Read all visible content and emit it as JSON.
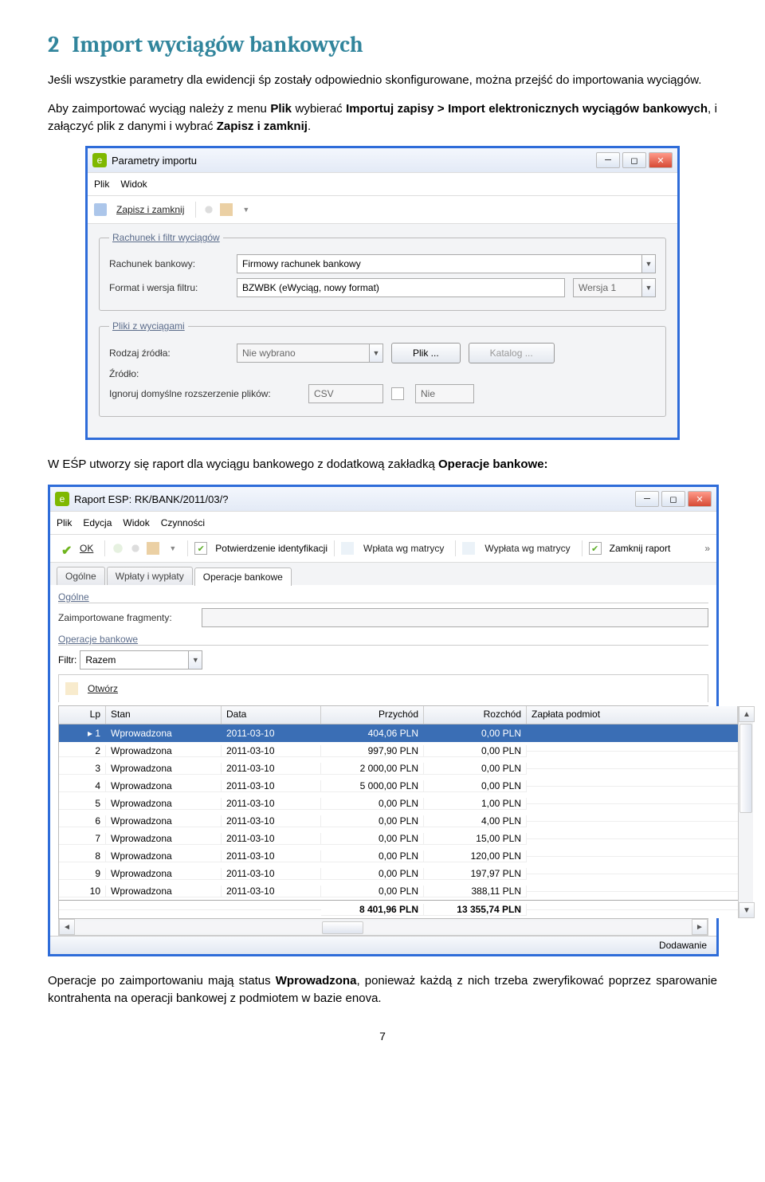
{
  "heading_num": "2",
  "heading_text": "Import wyciągów bankowych",
  "para1_a": "Jeśli wszystkie parametry dla ewidencji śp zostały odpowiednio skonfigurowane, można przejść do importowania wyciągów.",
  "para2_pre": "Aby zaimportować wyciąg należy z menu ",
  "para2_b1": "Plik",
  "para2_mid": " wybierać ",
  "para2_b2": "Importuj zapisy > Import elektronicznych wyciągów bankowych",
  "para2_mid2": ", i załączyć plik z danymi i wybrać ",
  "para2_b3": "Zapisz i zamknij",
  "para2_end": ".",
  "para3_pre": "W EŚP utworzy się raport dla wyciągu bankowego z dodatkową zakładką ",
  "para3_b": "Operacje bankowe:",
  "para4_pre": "Operacje po zaimportowaniu mają status ",
  "para4_b": "Wprowadzona",
  "para4_end": ", ponieważ każdą z nich trzeba zweryfikować poprzez sparowanie kontrahenta na operacji bankowej z podmiotem w bazie enova.",
  "page_num": "7",
  "win1": {
    "title": "Parametry importu",
    "menu": [
      "Plik",
      "Widok"
    ],
    "tb_save": "Zapisz i zamknij",
    "fs1": {
      "legend": "Rachunek i filtr wyciągów",
      "lbl_rach": "Rachunek bankowy:",
      "val_rach": "Firmowy rachunek bankowy",
      "lbl_format": "Format i wersja filtru:",
      "val_format": "BZWBK (eWyciąg, nowy format)",
      "val_wersja": "Wersja 1"
    },
    "fs2": {
      "legend": "Pliki z wyciągami",
      "lbl_rodzaj": "Rodzaj źródła:",
      "val_rodzaj": "Nie wybrano",
      "btn_plik": "Plik ...",
      "btn_katalog": "Katalog ...",
      "lbl_zrodlo": "Źródło:",
      "lbl_ignore": "Ignoruj domyślne rozszerzenie plików:",
      "val_csv": "CSV",
      "val_nie": "Nie"
    }
  },
  "win2": {
    "title": "Raport ESP: RK/BANK/2011/03/?",
    "menu": [
      "Plik",
      "Edycja",
      "Widok",
      "Czynności"
    ],
    "tb": {
      "ok": "OK",
      "chk1": "Potwierdzenie identyfikacji",
      "btn_wpl": "Wpłata wg matrycy",
      "btn_wypl": "Wypłata wg matrycy",
      "chk2": "Zamknij raport"
    },
    "tabs": [
      "Ogólne",
      "Wpłaty i wypłaty",
      "Operacje bankowe"
    ],
    "sect_ogolne": "Ogólne",
    "lbl_fragmenty": "Zaimportowane fragmenty:",
    "sect_operacje": "Operacje bankowe",
    "lbl_filtr": "Filtr:",
    "val_filtr": "Razem",
    "btn_otworz": "Otwórz",
    "headers": {
      "lp": "Lp",
      "stan": "Stan",
      "data": "Data",
      "przychod": "Przychód",
      "rozchod": "Rozchód",
      "podmiot": "Zapłata podmiot"
    },
    "sum": {
      "przychod": "8 401,96 PLN",
      "rozchod": "13 355,74 PLN"
    },
    "status": "Dodawanie"
  },
  "chart_data": {
    "type": "table",
    "title": "Operacje bankowe",
    "columns": [
      "Lp",
      "Stan",
      "Data",
      "Przychód",
      "Rozchód",
      "Zapłata podmiot"
    ],
    "rows": [
      {
        "lp": 1,
        "stan": "Wprowadzona",
        "data": "2011-03-10",
        "przychod": "404,06 PLN",
        "rozchod": "0,00 PLN",
        "podmiot": ""
      },
      {
        "lp": 2,
        "stan": "Wprowadzona",
        "data": "2011-03-10",
        "przychod": "997,90 PLN",
        "rozchod": "0,00 PLN",
        "podmiot": ""
      },
      {
        "lp": 3,
        "stan": "Wprowadzona",
        "data": "2011-03-10",
        "przychod": "2 000,00 PLN",
        "rozchod": "0,00 PLN",
        "podmiot": ""
      },
      {
        "lp": 4,
        "stan": "Wprowadzona",
        "data": "2011-03-10",
        "przychod": "5 000,00 PLN",
        "rozchod": "0,00 PLN",
        "podmiot": ""
      },
      {
        "lp": 5,
        "stan": "Wprowadzona",
        "data": "2011-03-10",
        "przychod": "0,00 PLN",
        "rozchod": "1,00 PLN",
        "podmiot": ""
      },
      {
        "lp": 6,
        "stan": "Wprowadzona",
        "data": "2011-03-10",
        "przychod": "0,00 PLN",
        "rozchod": "4,00 PLN",
        "podmiot": ""
      },
      {
        "lp": 7,
        "stan": "Wprowadzona",
        "data": "2011-03-10",
        "przychod": "0,00 PLN",
        "rozchod": "15,00 PLN",
        "podmiot": ""
      },
      {
        "lp": 8,
        "stan": "Wprowadzona",
        "data": "2011-03-10",
        "przychod": "0,00 PLN",
        "rozchod": "120,00 PLN",
        "podmiot": ""
      },
      {
        "lp": 9,
        "stan": "Wprowadzona",
        "data": "2011-03-10",
        "przychod": "0,00 PLN",
        "rozchod": "197,97 PLN",
        "podmiot": ""
      },
      {
        "lp": 10,
        "stan": "Wprowadzona",
        "data": "2011-03-10",
        "przychod": "0,00 PLN",
        "rozchod": "388,11 PLN",
        "podmiot": ""
      }
    ]
  }
}
